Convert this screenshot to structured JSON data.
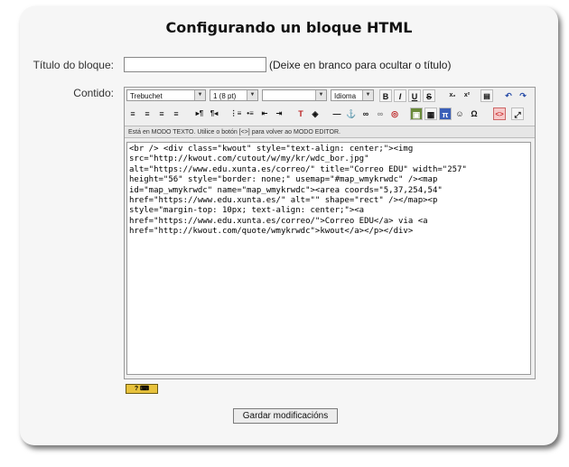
{
  "page": {
    "title": "Configurando un bloque HTML"
  },
  "form": {
    "title_label": "Título do bloque:",
    "title_value": "",
    "title_hint": "(Deixe en branco para ocultar o título)",
    "content_label": "Contido:"
  },
  "toolbar": {
    "font": "Trebuchet",
    "size": "1 (8 pt)",
    "format": "",
    "language": "Idioma",
    "bold": "B",
    "italic": "I",
    "underline": "U",
    "strike": "S"
  },
  "editor": {
    "status_text": "Está en MODO TEXTO. Utilice o botón [<>] para volver ao MODO EDITOR.",
    "code_lines": [
      "<br /> <div class=\"kwout\" style=\"text-align: center;\"><img",
      "src=\"http://kwout.com/cutout/w/my/kr/wdc_bor.jpg\"",
      "alt=\"https://www.edu.xunta.es/correo/\" title=\"Correo EDU\" width=\"257\"",
      "height=\"56\" style=\"border: none;\" usemap=\"#map_wmykrwdc\" /><map",
      "id=\"map_wmykrwdc\" name=\"map_wmykrwdc\"><area coords=\"5,37,254,54\"",
      "href=\"https://www.edu.xunta.es/\" alt=\"\" shape=\"rect\" /></map><p",
      "style=\"margin-top: 10px; text-align: center;\"><a",
      "href=\"https://www.edu.xunta.es/correo/\">Correo EDU</a> via <a",
      "href=\"http://kwout.com/quote/wmykrwdc\">kwout</a></p></div>"
    ]
  },
  "help_label": "?",
  "save_label": "Gardar modificacións"
}
